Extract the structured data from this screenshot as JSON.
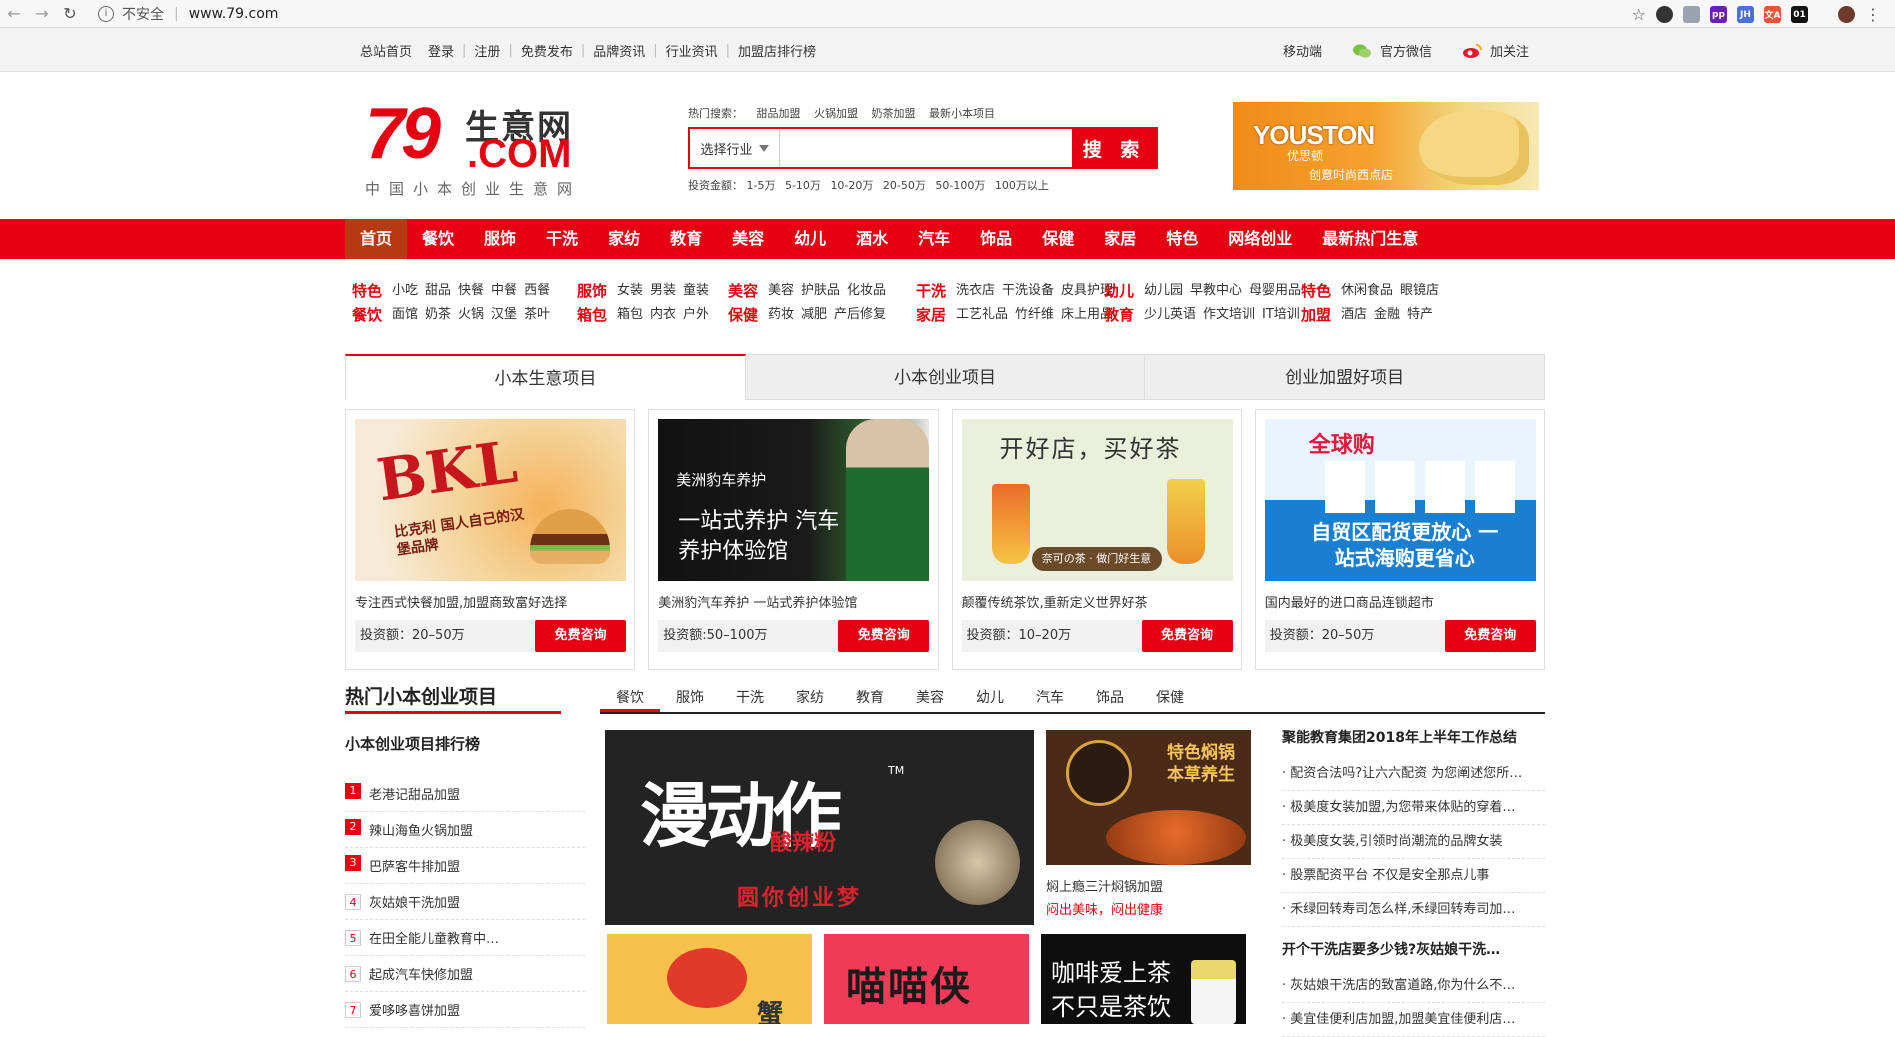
{
  "browser": {
    "security": "不安全",
    "url": "www.79.com",
    "extensions": [
      {
        "icon": "github-icon",
        "text": "",
        "color": "#333333"
      },
      {
        "icon": "figure-icon",
        "text": "",
        "color": "#9aa4b0"
      },
      {
        "icon": "pp-icon",
        "text": "pp",
        "color": "#6a1fb0"
      },
      {
        "icon": "jh-icon",
        "text": "JH",
        "color": "#4a6fd8"
      },
      {
        "icon": "translate-icon",
        "text": "文A",
        "color": "#e8543a"
      },
      {
        "icon": "01-icon",
        "text": "01",
        "color": "#111111"
      }
    ]
  },
  "topbar": {
    "links": [
      "总站首页",
      "登录",
      "注册",
      "免费发布",
      "品牌资讯",
      "行业资讯",
      "加盟店排行榜"
    ],
    "mobile": "移动端",
    "wechat": "官方微信",
    "weibo": "加关注"
  },
  "logo": {
    "num": "79",
    "cn": "生意网",
    "com": ".COM",
    "slogan": "中国小本创业生意网"
  },
  "search": {
    "hot_label": "热门搜索：",
    "hot": [
      "甜品加盟",
      "火锅加盟",
      "奶茶加盟",
      "最新小本项目"
    ],
    "select": "选择行业",
    "button": "搜 索",
    "invest_label": "投资金额：",
    "invest": [
      "1-5万",
      "5-10万",
      "10-20万",
      "20-50万",
      "50-100万",
      "100万以上"
    ]
  },
  "ad": {
    "brand": "YOUSTON",
    "brand_cn": "优思顿",
    "slogan": "创意时尚西点店"
  },
  "mainnav": [
    "首页",
    "餐饮",
    "服饰",
    "干洗",
    "家纺",
    "教育",
    "美容",
    "幼儿",
    "酒水",
    "汽车",
    "饰品",
    "保健",
    "家居",
    "特色",
    "网络创业",
    "最新热门生意"
  ],
  "categories": [
    {
      "t1": "特色",
      "t2": "餐饮",
      "r1": [
        "小吃",
        "甜品",
        "快餐",
        "中餐",
        "西餐"
      ],
      "r2": [
        "面馆",
        "奶茶",
        "火锅",
        "汉堡",
        "茶叶"
      ]
    },
    {
      "t1": "服饰",
      "t2": "箱包",
      "r1": [
        "女装",
        "男装",
        "童装"
      ],
      "r2": [
        "箱包",
        "内衣",
        "户外"
      ]
    },
    {
      "t1": "美容",
      "t2": "保健",
      "r1": [
        "美容",
        "护肤品",
        "化妆品"
      ],
      "r2": [
        "药妆",
        "减肥",
        "产后修复"
      ]
    },
    {
      "t1": "干洗",
      "t2": "家居",
      "r1": [
        "洗衣店",
        "干洗设备",
        "皮具护理"
      ],
      "r2": [
        "工艺礼品",
        "竹纤维",
        "床上用品"
      ]
    },
    {
      "t1": "幼儿",
      "t2": "教育",
      "r1": [
        "幼儿园",
        "早教中心",
        "母婴用品"
      ],
      "r2": [
        "少儿英语",
        "作文培训",
        "IT培训"
      ]
    },
    {
      "t1": "特色",
      "t2": "加盟",
      "r1": [
        "休闲食品",
        "眼镜店"
      ],
      "r2": [
        "酒店",
        "金融",
        "特产"
      ]
    }
  ],
  "tabs": [
    "小本生意项目",
    "小本创业项目",
    "创业加盟好项目"
  ],
  "cards": [
    {
      "desc": "专注西式快餐加盟,加盟商致富好选择",
      "amount": "投资额：20–50万",
      "btn": "免费咨询",
      "img_title": "BKL",
      "img_sub": "比克利 国人自己的汉堡品牌"
    },
    {
      "desc": "美洲豹汽车养护 一站式养护体验馆",
      "amount": "投资额:50–100万",
      "btn": "免费咨询",
      "img_title": "美洲豹车养护",
      "img_sub": "一站式养护 汽车养护体验馆"
    },
    {
      "desc": "颠覆传统茶饮,重新定义世界好茶",
      "amount": "投资额：10–20万",
      "btn": "免费咨询",
      "img_title": "开好店，买好茶",
      "img_sub": "奈可の茶 · 做门好生意"
    },
    {
      "desc": "国内最好的进口商品连锁超市",
      "amount": "投资额：20–50万",
      "btn": "免费咨询",
      "img_title": "全球购",
      "img_sub": "自贸区配货更放心 一站式海购更省心"
    }
  ],
  "hot": {
    "title": "热门小本创业项目",
    "tabs": [
      "餐饮",
      "服饰",
      "干洗",
      "家纺",
      "教育",
      "美容",
      "幼儿",
      "汽车",
      "饰品",
      "保健"
    ],
    "rank_title": "小本创业项目排行榜",
    "rank": [
      "老港记甜品加盟",
      "辣山海鱼火锅加盟",
      "巴萨客牛排加盟",
      "灰姑娘干洗加盟",
      "在田全能儿童教育中…",
      "起成汽车快修加盟",
      "爱哆哆喜饼加盟"
    ],
    "big_img": {
      "title": "漫动作",
      "sub": "酸辣粉",
      "slogan": "圆你创业梦",
      "tm": "TM"
    },
    "side": {
      "img_text": "特色焖锅 本草养生",
      "name": "焖上瘾三汁焖锅加盟",
      "sub": "闷出美味，闷出健康"
    },
    "row3": [
      "蟹",
      "喵喵侠",
      "咖啡爱上茶 不只是茶饮"
    ]
  },
  "news": {
    "groups": [
      {
        "title": "聚能教育集团2018年上半年工作总结",
        "items": [
          "配资合法吗?让六六配资 为您阐述您所…",
          "极美度女装加盟,为您带来体贴的穿着…",
          "极美度女装,引领时尚潮流的品牌女装",
          "股票配资平台 不仅是安全那点儿事",
          "禾绿回转寿司怎么样,禾绿回转寿司加…"
        ]
      },
      {
        "title": "开个干洗店要多少钱?灰姑娘干洗…",
        "items": [
          "灰姑娘干洗店的致富道路,你为什么不…",
          "美宜佳便利店加盟,加盟美宜佳便利店…"
        ]
      }
    ]
  }
}
